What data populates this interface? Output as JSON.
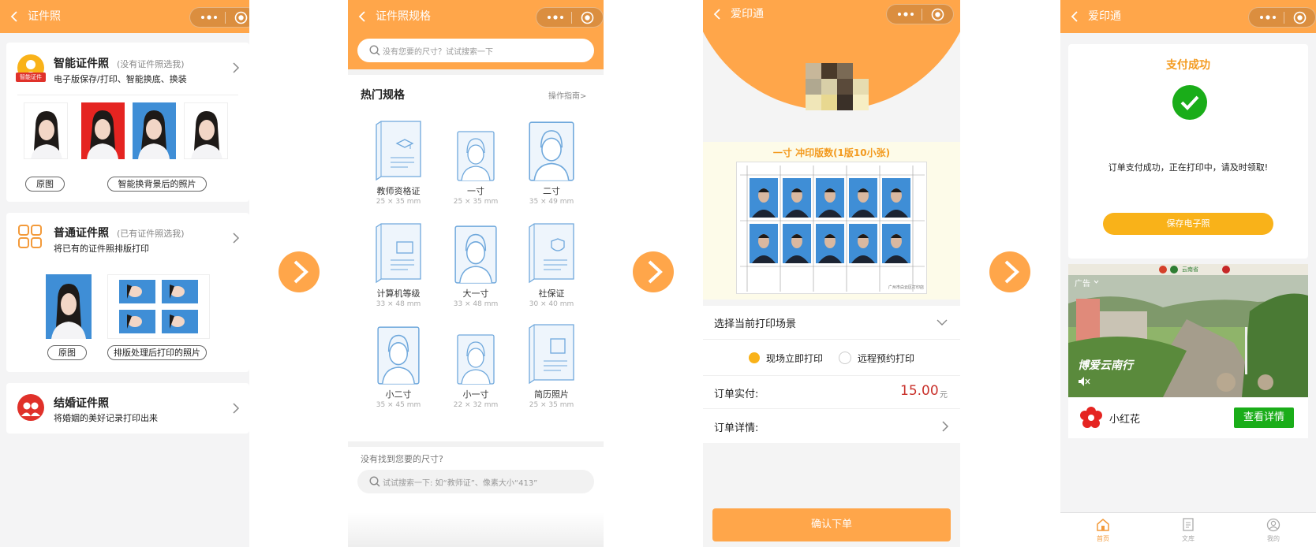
{
  "screen1": {
    "title": "证件照",
    "smart": {
      "icon_label": "智能证件",
      "title": "智能证件照",
      "hint": "(没有证件照选我)",
      "desc": "电子版保存/打印、智能换底、换装",
      "pill_original": "原图",
      "pill_result": "智能换背景后的照片"
    },
    "normal": {
      "title": "普通证件照",
      "hint": "(已有证件照选我)",
      "desc": "将已有的证件照排版打印",
      "pill_original": "原图",
      "pill_result": "排版处理后打印的照片"
    },
    "wedding": {
      "title": "结婚证件照",
      "desc": "将婚姻的美好记录打印出来"
    }
  },
  "screen2": {
    "title": "证件照规格",
    "search_placeholder": "没有您要的尺寸？试试搜索一下",
    "section_title": "热门规格",
    "guide_link": "操作指南>",
    "specs": [
      {
        "name": "教师资格证",
        "size": "25 × 35 mm",
        "icon": "certificate-book-icon"
      },
      {
        "name": "一寸",
        "size": "25 × 35 mm",
        "icon": "portrait-small-icon"
      },
      {
        "name": "二寸",
        "size": "35 × 49 mm",
        "icon": "portrait-large-icon"
      },
      {
        "name": "计算机等级",
        "size": "33 × 48 mm",
        "icon": "computer-book-icon"
      },
      {
        "name": "大一寸",
        "size": "33 × 48 mm",
        "icon": "portrait-medium-icon"
      },
      {
        "name": "社保证",
        "size": "30 × 40 mm",
        "icon": "social-security-book-icon"
      },
      {
        "name": "小二寸",
        "size": "35 × 45 mm",
        "icon": "portrait-medium-icon"
      },
      {
        "name": "小一寸",
        "size": "22 × 32 mm",
        "icon": "portrait-small-icon"
      },
      {
        "name": "简历照片",
        "size": "25 × 35 mm",
        "icon": "resume-book-icon"
      }
    ],
    "not_found": "没有找到您要的尺寸?",
    "bottom_search_placeholder": "试试搜索一下: 如“教师证”、像素大小“413”"
  },
  "screen3": {
    "title": "爱印通",
    "print_banner": "一寸 冲印版数(1版10小张)",
    "sheet_caption": "广州市白云区打印店",
    "scene_label": "选择当前打印场景",
    "options": [
      "现场立即打印",
      "远程预约打印"
    ],
    "selected_option": "现场立即打印",
    "order_paid_label": "订单实付:",
    "order_amount": "15.00",
    "currency": "元",
    "order_detail_label": "订单详情:",
    "confirm_button": "确认下单"
  },
  "screen4": {
    "title": "爱印通",
    "success_title": "支付成功",
    "success_msg": "订单支付成功，正在打印中，请及时领取!",
    "save_button": "保存电子照",
    "ad_label": "广告",
    "ad_caption": "博爱云南行",
    "ad_top_text": "云南省",
    "advertiser": "小红花",
    "detail_button": "查看详情",
    "tabs": [
      {
        "label": "首页",
        "icon": "home-icon",
        "active": true
      },
      {
        "label": "文库",
        "icon": "library-icon",
        "active": false
      },
      {
        "label": "我的",
        "icon": "profile-icon",
        "active": false
      }
    ]
  },
  "colors": {
    "accent": "#ffa64a",
    "yellow_button": "#f9b219",
    "success_green": "#1aad19",
    "price_red": "#c9312b",
    "photo_blue": "#3f8ed6",
    "photo_red": "#e52421"
  }
}
